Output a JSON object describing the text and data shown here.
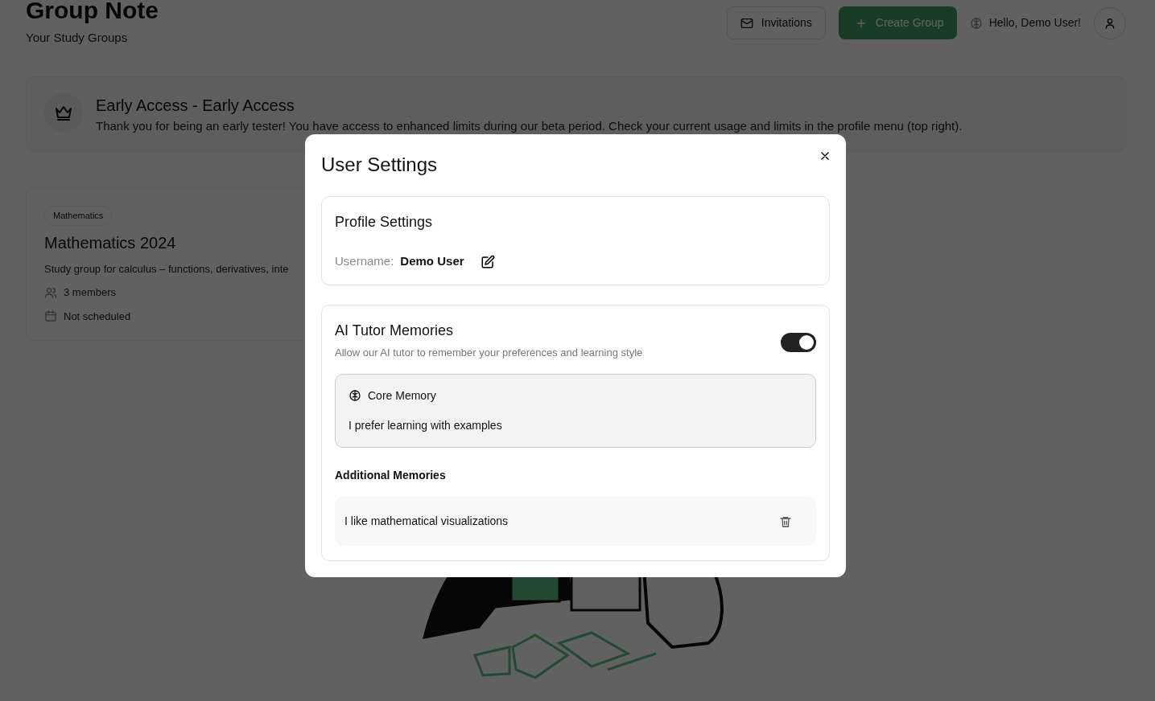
{
  "header": {
    "title": "Group Note",
    "subtitle": "Your Study Groups",
    "buttons": [
      {
        "label": "Invitations",
        "kind": "outline"
      },
      {
        "label": "Create Group",
        "kind": "primary"
      }
    ],
    "greeting": "Hello, Demo User!"
  },
  "banner": {
    "title": "Early Access - Early Access",
    "text": "Thank you for being an early tester! You have access to enhanced limits during our beta period. Check your current usage and limits in the profile menu (top right)."
  },
  "groups": [
    {
      "tag": "Mathematics",
      "title": "Mathematics 2024",
      "description": "Study group for calculus – functions, derivatives, inte",
      "members": "3 members",
      "schedule": "Not scheduled"
    }
  ],
  "modal": {
    "title": "User Settings",
    "profile": {
      "title": "Profile Settings",
      "label": "Username:",
      "value": "Demo User"
    },
    "memories": {
      "title": "AI Tutor Memories",
      "description": "Allow our AI tutor to remember your preferences and learning style",
      "enabled": true,
      "core": {
        "label": "Core Memory",
        "text": "I prefer learning with examples"
      },
      "additional_heading": "Additional Memories",
      "items": [
        {
          "text": "I like mathematical visualizations"
        }
      ]
    }
  }
}
